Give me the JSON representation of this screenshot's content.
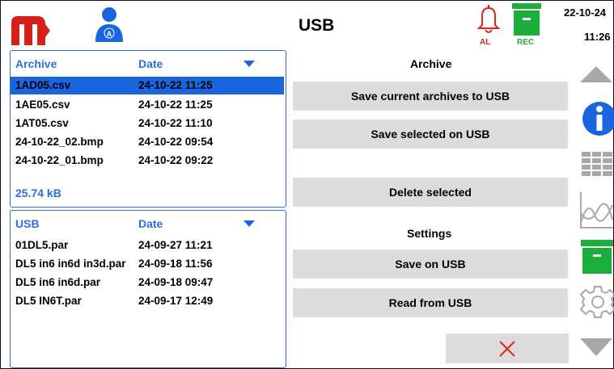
{
  "header": {
    "title": "USB",
    "user_badge": "A",
    "alarm_label": "AL",
    "record_label": "REC",
    "date": "22-10-24",
    "time": "11:26"
  },
  "archive_list": {
    "col_name": "Archive",
    "col_date": "Date",
    "rows": [
      {
        "name": "1AD05.csv",
        "date": "24-10-22 11:25",
        "selected": true
      },
      {
        "name": "1AE05.csv",
        "date": "24-10-22 11:25"
      },
      {
        "name": "1AT05.csv",
        "date": "24-10-22 11:10"
      },
      {
        "name": "24-10-22_02.bmp",
        "date": "24-10-22 09:54"
      },
      {
        "name": "24-10-22_01.bmp",
        "date": "24-10-22 09:22"
      }
    ],
    "size": "25.74 kB"
  },
  "usb_list": {
    "col_name": "USB",
    "col_date": "Date",
    "rows": [
      {
        "name": "01DL5.par",
        "date": "24-09-27 11:21"
      },
      {
        "name": "DL5 in6 in6d in3d.par",
        "date": "24-09-18 11:56"
      },
      {
        "name": "DL5 in6 in6d.par",
        "date": "24-09-18 09:47"
      },
      {
        "name": "DL5 IN6T.par",
        "date": "24-09-17 12:49"
      }
    ]
  },
  "actions": {
    "archive_heading": "Archive",
    "save_current": "Save current archives to USB",
    "save_selected": "Save selected on USB",
    "delete_selected": "Delete selected",
    "settings_heading": "Settings",
    "save_on_usb": "Save on USB",
    "read_from_usb": "Read from USB"
  },
  "colors": {
    "brand_red": "#d6201b",
    "accent_blue": "#1a66e0",
    "record_green": "#1cae3a",
    "button_gray": "#dcdcdc",
    "nav_gray": "#a8a8a8"
  },
  "icons": [
    "logo-icon",
    "user-icon",
    "alarm-bell-icon",
    "record-archive-icon",
    "scroll-up-icon",
    "info-icon",
    "table-view-icon",
    "chart-view-icon",
    "archive-view-icon",
    "settings-gear-icon",
    "scroll-down-icon",
    "close-icon"
  ]
}
